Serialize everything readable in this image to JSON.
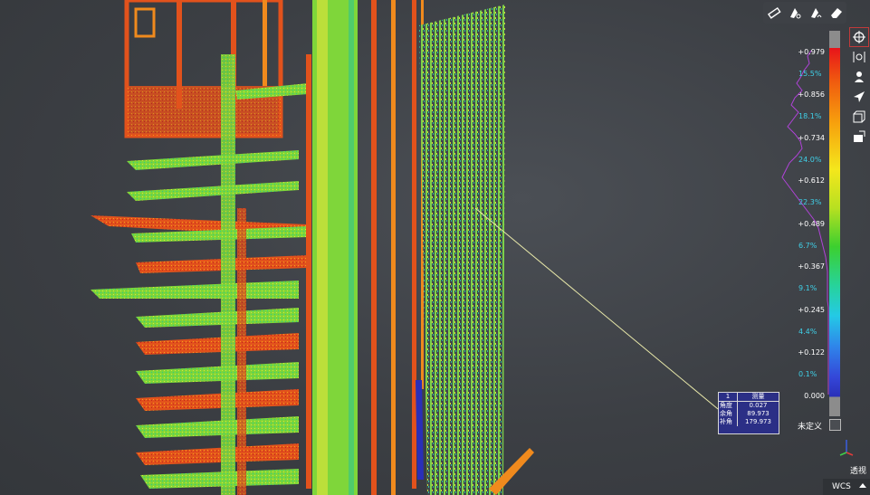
{
  "legend": {
    "ticks": [
      "+0.979",
      "+0.856",
      "+0.734",
      "+0.612",
      "+0.489",
      "+0.367",
      "+0.245",
      "+0.122",
      "0.000"
    ],
    "percentages": [
      "15.5%",
      "18.1%",
      "24.0%",
      "22.3%",
      "6.7%",
      "9.1%",
      "4.4%",
      "0.1%"
    ],
    "undefined_label": "未定义",
    "percent_color": "#3fd0e8",
    "histogram_color": "#b043d8"
  },
  "measurement": {
    "index": "1",
    "header": "测量",
    "rows": [
      {
        "label": "角度",
        "value": "0.027"
      },
      {
        "label": "余角",
        "value": "89.973"
      },
      {
        "label": "补角",
        "value": "179.973"
      }
    ]
  },
  "view": {
    "projection_label": "透视",
    "coordinate_system": "WCS"
  },
  "toolbar": {
    "top": [
      "ruler-icon",
      "pick-point-icon",
      "pick-curve-icon",
      "eraser-icon"
    ],
    "right": [
      "rotate-center-icon",
      "fit-view-icon",
      "user-view-icon",
      "navigate-icon",
      "box-view-icon",
      "screenshot-icon"
    ]
  },
  "colors": {
    "background": "#3c3f44",
    "measure_box": "#2b2f86",
    "leader_line": "#e6e6a8"
  }
}
